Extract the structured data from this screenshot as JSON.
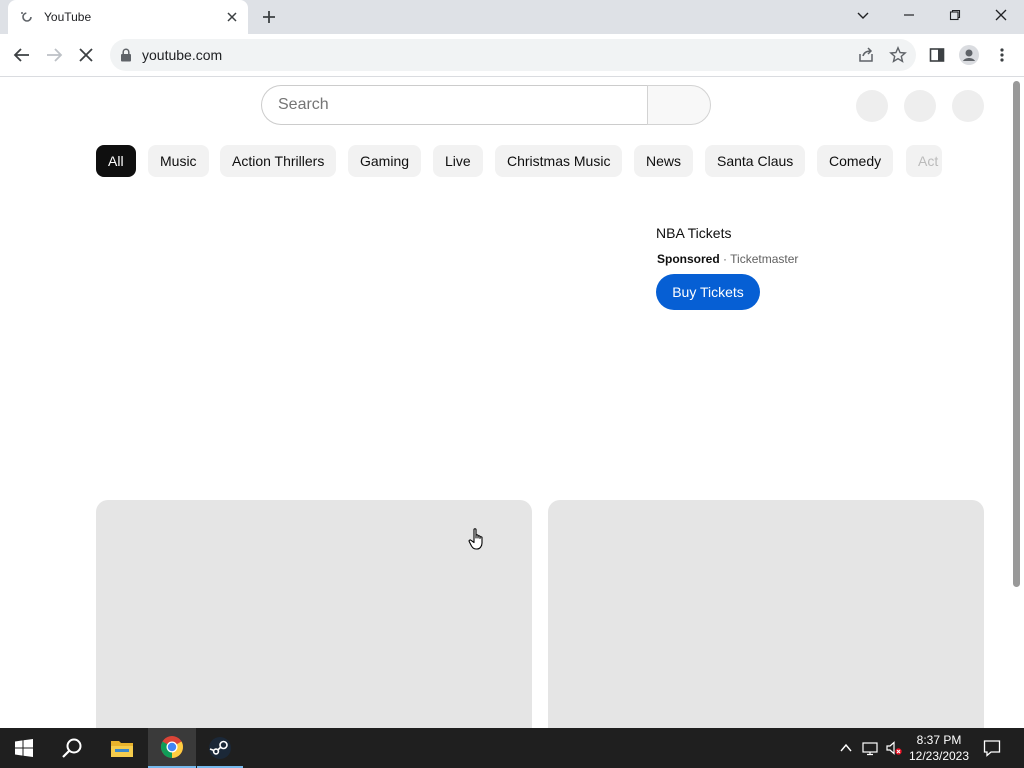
{
  "browser": {
    "tab_title": "YouTube",
    "url": "youtube.com"
  },
  "youtube": {
    "search_placeholder": "Search",
    "chips": [
      "All",
      "Music",
      "Action Thrillers",
      "Gaming",
      "Live",
      "Christmas Music",
      "News",
      "Santa Claus",
      "Comedy",
      "Act"
    ],
    "ad": {
      "title": "NBA Tickets",
      "sponsored": "Sponsored",
      "separator": "·",
      "advertiser": "Ticketmaster",
      "cta": "Buy Tickets"
    }
  },
  "taskbar": {
    "time": "8:37 PM",
    "date": "12/23/2023"
  },
  "colors": {
    "accent": "#065fd4",
    "chip_active": "#0f0f0f",
    "skeleton": "#e5e5e5"
  },
  "icons": [
    "youtube-favicon-icon",
    "close-icon",
    "plus-icon",
    "chevron-down-icon",
    "minimize-icon",
    "restore-icon",
    "back-icon",
    "forward-icon",
    "stop-loading-icon",
    "lock-icon",
    "share-icon",
    "star-icon",
    "side-panel-icon",
    "profile-icon",
    "menu-dots-icon",
    "windows-start-icon",
    "search-icon",
    "file-explorer-icon",
    "chrome-icon",
    "steam-icon",
    "chevron-up-icon",
    "network-icon",
    "volume-muted-icon",
    "notification-icon"
  ]
}
